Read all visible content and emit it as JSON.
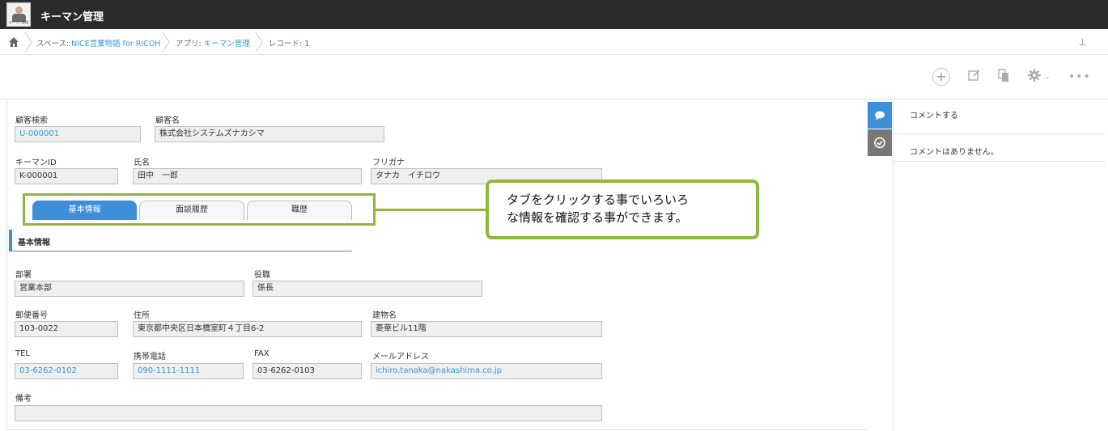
{
  "header": {
    "app_title": "キーマン管理",
    "app_icon_text": "キーマン管理"
  },
  "breadcrumb": {
    "space_prefix": "スペース: ",
    "space_name": "NICE営業物語 for RICOH",
    "app_prefix": "アプリ: ",
    "app_name": "キーマン管理",
    "record": "レコード: 1"
  },
  "toolbar": {
    "icons": [
      "add-icon",
      "edit-icon",
      "copy-icon",
      "gear-icon",
      "more-icon"
    ]
  },
  "form": {
    "customer_search": {
      "label": "顧客検索",
      "value": "U-000001"
    },
    "customer_name": {
      "label": "顧客名",
      "value": "株式会社システムズナカシマ"
    },
    "keyman_id": {
      "label": "キーマンID",
      "value": "K-000001"
    },
    "name": {
      "label": "氏名",
      "value": "田中　一郎"
    },
    "furigana": {
      "label": "フリガナ",
      "value": "タナカ　イチロウ"
    },
    "tabs": [
      "基本情報",
      "面談履歴",
      "職歴"
    ],
    "section_title": "基本情報",
    "department": {
      "label": "部署",
      "value": "営業本部"
    },
    "position": {
      "label": "役職",
      "value": "係長"
    },
    "postal_code": {
      "label": "郵便番号",
      "value": "103-0022"
    },
    "address": {
      "label": "住所",
      "value": "東京都中央区日本橋室町４丁目6-2"
    },
    "building": {
      "label": "建物名",
      "value": "菱華ビル11階"
    },
    "tel": {
      "label": "TEL",
      "value": "03-6262-0102"
    },
    "mobile": {
      "label": "携帯電話",
      "value": "090-1111-1111"
    },
    "fax": {
      "label": "FAX",
      "value": "03-6262-0103"
    },
    "email": {
      "label": "メールアドレス",
      "value": "ichiro.tanaka@nakashima.co.jp"
    },
    "notes": {
      "label": "備考",
      "value": ""
    }
  },
  "callout": {
    "line1": "タブをクリックする事でいろいろ",
    "line2": "な情報を確認する事ができます。"
  },
  "comments": {
    "input_label": "コメントする",
    "empty_text": "コメントはありません。"
  },
  "colors": {
    "accent": "#3c8fd8",
    "callout_border": "#8db73d",
    "header_bg": "#2b2b2b"
  }
}
